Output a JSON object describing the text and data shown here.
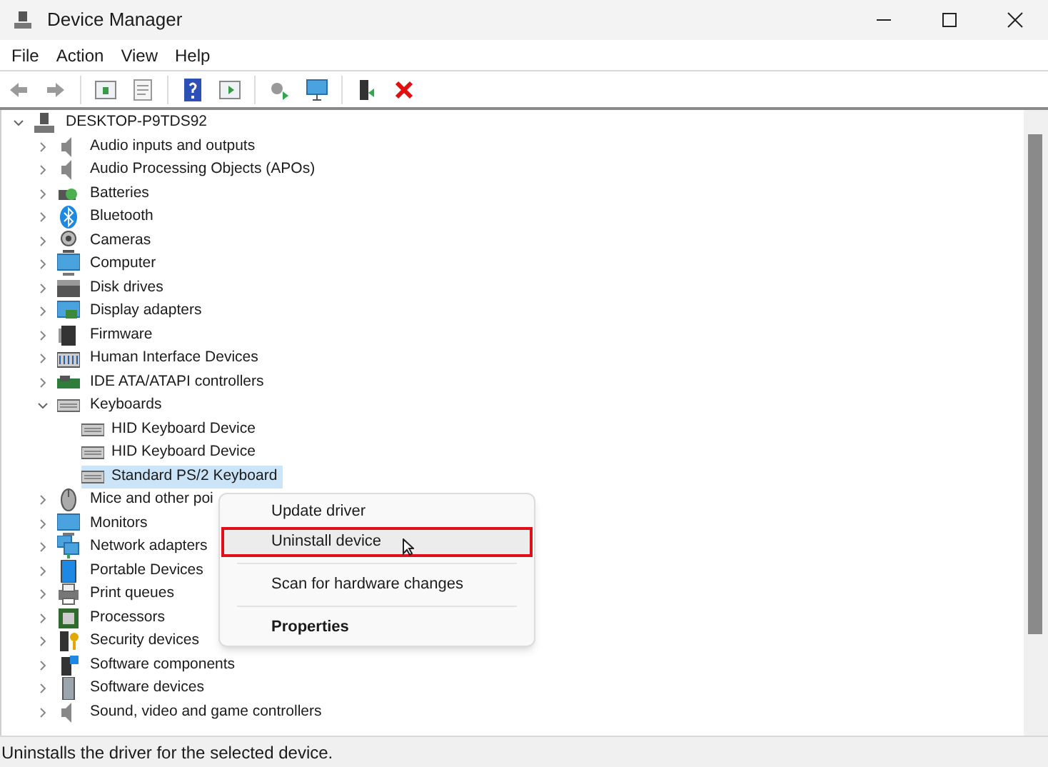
{
  "window": {
    "title": "Device Manager"
  },
  "menu": [
    "File",
    "Action",
    "View",
    "Help"
  ],
  "tree": {
    "label": "DESKTOP-P9TDS92",
    "expanded": true,
    "children": [
      {
        "label": "Audio inputs and outputs",
        "expanded": false
      },
      {
        "label": "Audio Processing Objects (APOs)",
        "expanded": false
      },
      {
        "label": "Batteries",
        "expanded": false
      },
      {
        "label": "Bluetooth",
        "expanded": false
      },
      {
        "label": "Cameras",
        "expanded": false
      },
      {
        "label": "Computer",
        "expanded": false
      },
      {
        "label": "Disk drives",
        "expanded": false
      },
      {
        "label": "Display adapters",
        "expanded": false
      },
      {
        "label": "Firmware",
        "expanded": false
      },
      {
        "label": "Human Interface Devices",
        "expanded": false
      },
      {
        "label": "IDE ATA/ATAPI controllers",
        "expanded": false
      },
      {
        "label": "Keyboards",
        "expanded": true,
        "children": [
          {
            "label": "HID Keyboard Device",
            "selected": false
          },
          {
            "label": "HID Keyboard Device",
            "selected": false
          },
          {
            "label": "Standard PS/2 Keyboard",
            "selected": true
          }
        ]
      },
      {
        "label": "Mice and other poi",
        "expanded": false
      },
      {
        "label": "Monitors",
        "expanded": false
      },
      {
        "label": "Network adapters",
        "expanded": false
      },
      {
        "label": "Portable Devices",
        "expanded": false
      },
      {
        "label": "Print queues",
        "expanded": false
      },
      {
        "label": "Processors",
        "expanded": false
      },
      {
        "label": "Security devices",
        "expanded": false
      },
      {
        "label": "Software components",
        "expanded": false
      },
      {
        "label": "Software devices",
        "expanded": false
      },
      {
        "label": "Sound, video and game controllers",
        "expanded": false
      }
    ]
  },
  "context_menu": [
    {
      "label": "Update driver",
      "selected": false,
      "bold": false
    },
    {
      "label": "Uninstall device",
      "selected": true,
      "bold": false
    },
    {
      "label": "Scan for hardware changes",
      "selected": false,
      "bold": false
    },
    {
      "label": "Properties",
      "selected": false,
      "bold": true
    }
  ],
  "status_bar": "Uninstalls the driver for the selected device."
}
